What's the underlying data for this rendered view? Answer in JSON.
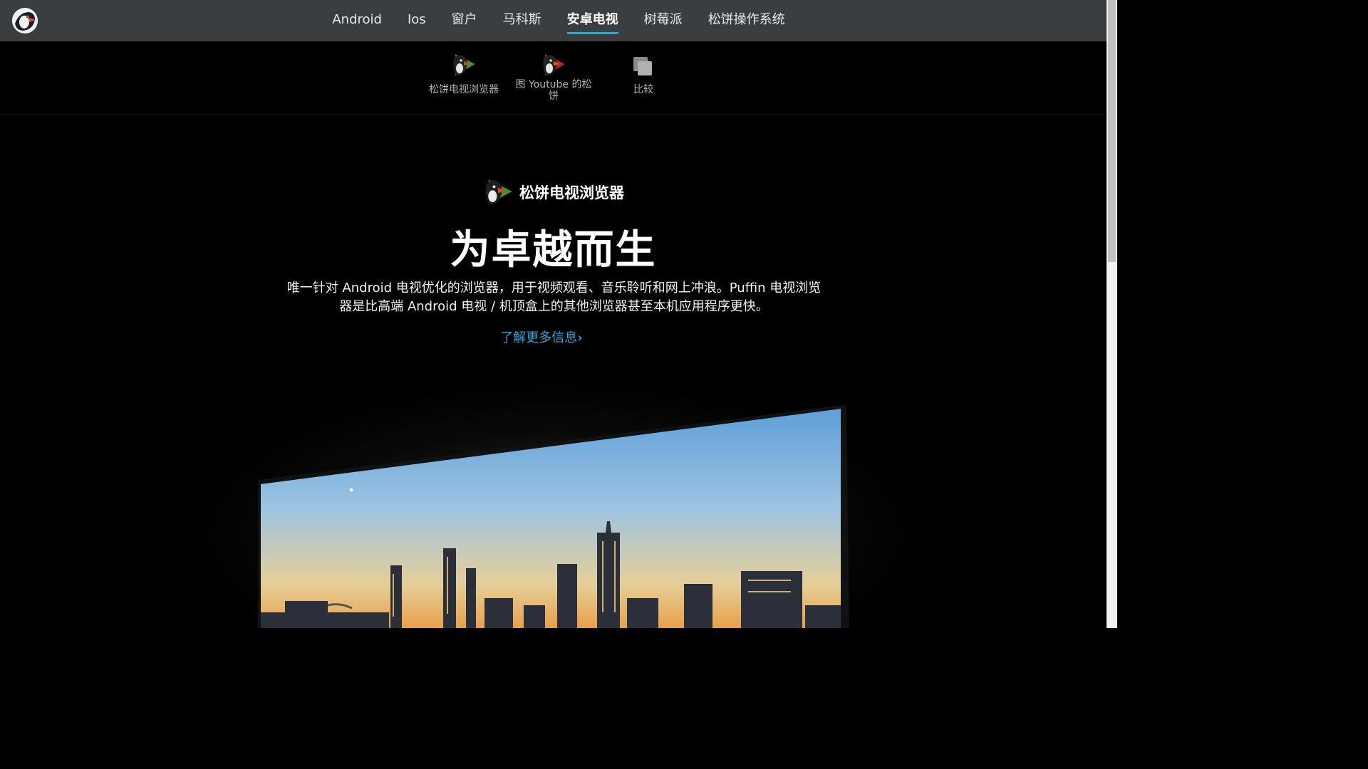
{
  "nav": {
    "logo_icon": "puffin-logo-icon",
    "links": [
      "Android",
      "Ios",
      "窗户",
      "马科斯",
      "安卓电视",
      "树莓派",
      "松饼操作系统"
    ],
    "active_index": 4,
    "accent": "#29a6c9"
  },
  "subnav": {
    "items": [
      {
        "label": "松饼电视浏览器",
        "icon": "puffin-tv-icon"
      },
      {
        "label": "图 Youtube 的松饼",
        "icon": "puffin-youtube-icon"
      },
      {
        "label": "比较",
        "icon": "compare-icon"
      }
    ]
  },
  "hero": {
    "product_name": "松饼电视浏览器",
    "headline": "为卓越而生",
    "description": "唯一针对 Android 电视优化的浏览器，用于视频观看、音乐聆听和网上冲浪。Puffin 电视浏览器是比高端 Android 电视 / 机顶盒上的其他浏览器甚至本机应用程序更快。",
    "learn_more": "了解更多信息",
    "link_color": "#2aa7dc"
  }
}
